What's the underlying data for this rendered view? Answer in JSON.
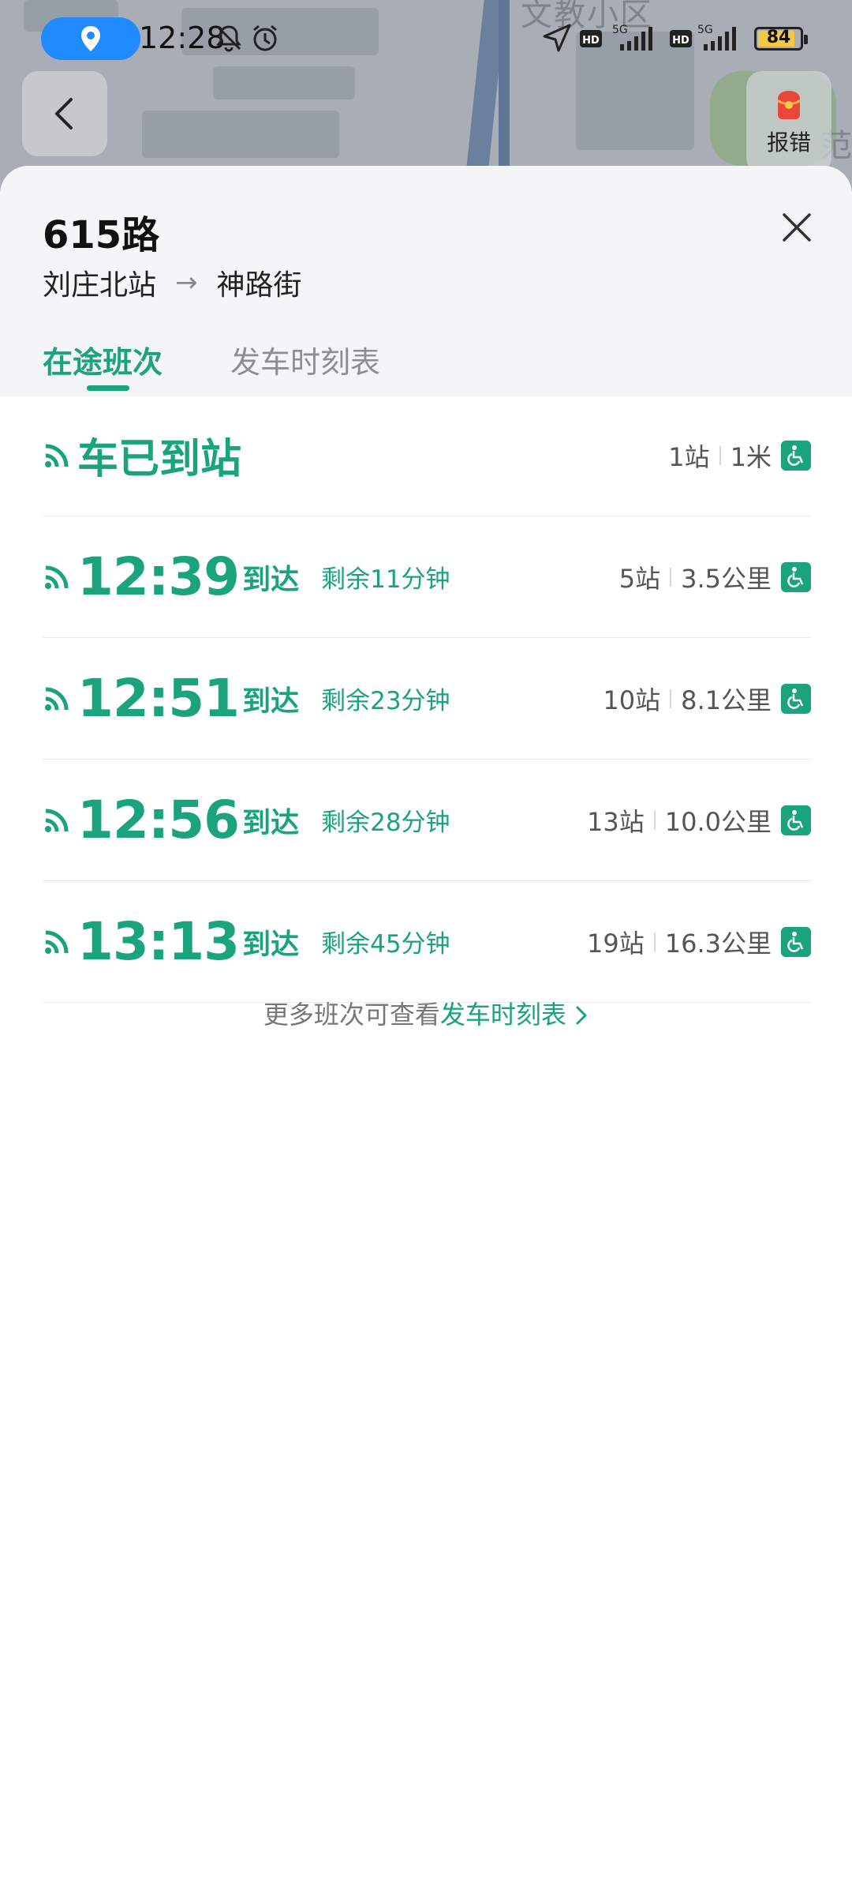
{
  "status_bar": {
    "time": "12:28",
    "battery": "84",
    "icons": [
      "location-pill-icon",
      "bell-muted-icon",
      "alarm-icon",
      "navigation-icon",
      "hd-icon",
      "signal-5g-icon",
      "hd-icon",
      "signal-5g-icon",
      "battery-icon"
    ]
  },
  "map": {
    "label_top": "文教小区",
    "label_right": "范"
  },
  "report_button": {
    "label": "报错"
  },
  "route": {
    "title": "615路",
    "from": "刘庄北站",
    "to": "神路街",
    "arrow": "→"
  },
  "tabs": [
    {
      "label": "在途班次",
      "active": true
    },
    {
      "label": "发车时刻表",
      "active": false
    }
  ],
  "accent_color": "#1ba37e",
  "buses": [
    {
      "status": "车已到站",
      "stops": "1站",
      "distance": "1米",
      "accessible": true
    },
    {
      "time": "12:39",
      "arrive": "到达",
      "remaining": "剩余11分钟",
      "stops": "5站",
      "distance": "3.5公里",
      "accessible": true
    },
    {
      "time": "12:51",
      "arrive": "到达",
      "remaining": "剩余23分钟",
      "stops": "10站",
      "distance": "8.1公里",
      "accessible": true
    },
    {
      "time": "12:56",
      "arrive": "到达",
      "remaining": "剩余28分钟",
      "stops": "13站",
      "distance": "10.0公里",
      "accessible": true
    },
    {
      "time": "13:13",
      "arrive": "到达",
      "remaining": "剩余45分钟",
      "stops": "19站",
      "distance": "16.3公里",
      "accessible": true
    }
  ],
  "footer": {
    "prefix": "更多班次可查看",
    "link": "发车时刻表"
  }
}
